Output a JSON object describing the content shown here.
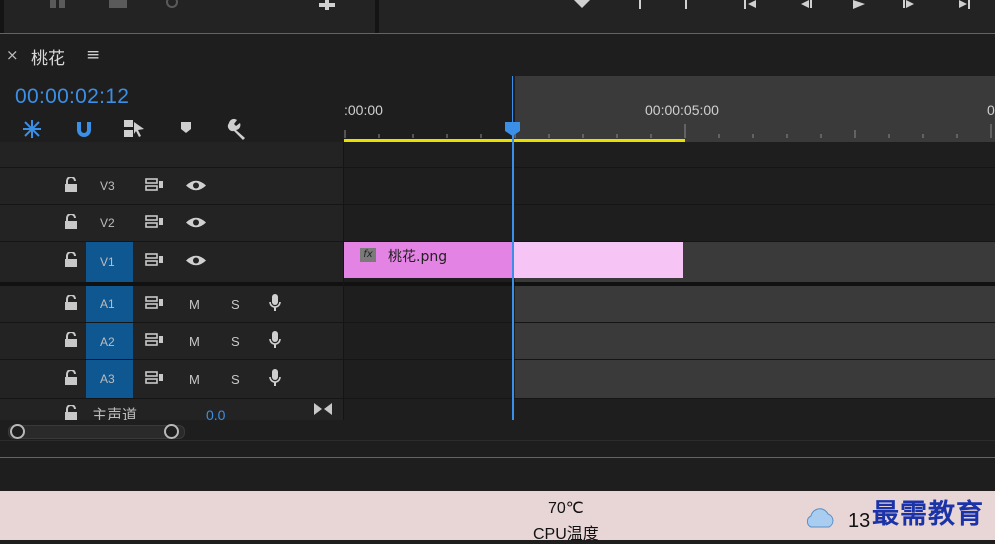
{
  "sequence": {
    "title": "桃花",
    "close_glyph": "×",
    "menu_glyph": "≡",
    "timecode": "00:00:02:12"
  },
  "ruler": {
    "labels": [
      ":00:00",
      "00:00:05:00",
      "0"
    ]
  },
  "tracks": {
    "video": [
      {
        "name": "V3",
        "targeted": false
      },
      {
        "name": "V2",
        "targeted": false
      },
      {
        "name": "V1",
        "targeted": true
      }
    ],
    "audio": [
      {
        "name": "A1",
        "mute": "M",
        "solo": "S",
        "targeted": true
      },
      {
        "name": "A2",
        "mute": "M",
        "solo": "S",
        "targeted": true
      },
      {
        "name": "A3",
        "mute": "M",
        "solo": "S",
        "targeted": true
      }
    ],
    "master": {
      "name": "主声道",
      "value": "0.0"
    }
  },
  "clip": {
    "fx": "fx",
    "name": "桃花.png"
  },
  "taskbar": {
    "temperature": "70℃",
    "cpu_label": "CPU温度",
    "weather_temp": "13",
    "watermark": "最需教育"
  },
  "colors": {
    "accent": "#3b8fe6",
    "clip": "#e383e3",
    "clip_light": "#f6c5f6",
    "workarea": "#e8e000",
    "track_target": "#0f5790"
  },
  "icons": [
    "snap-icon",
    "magnet-icon",
    "linked-selection-icon",
    "marker-icon",
    "wrench-icon",
    "lock-icon",
    "sync-icon",
    "eye-icon",
    "mic-icon",
    "cloud-icon"
  ]
}
